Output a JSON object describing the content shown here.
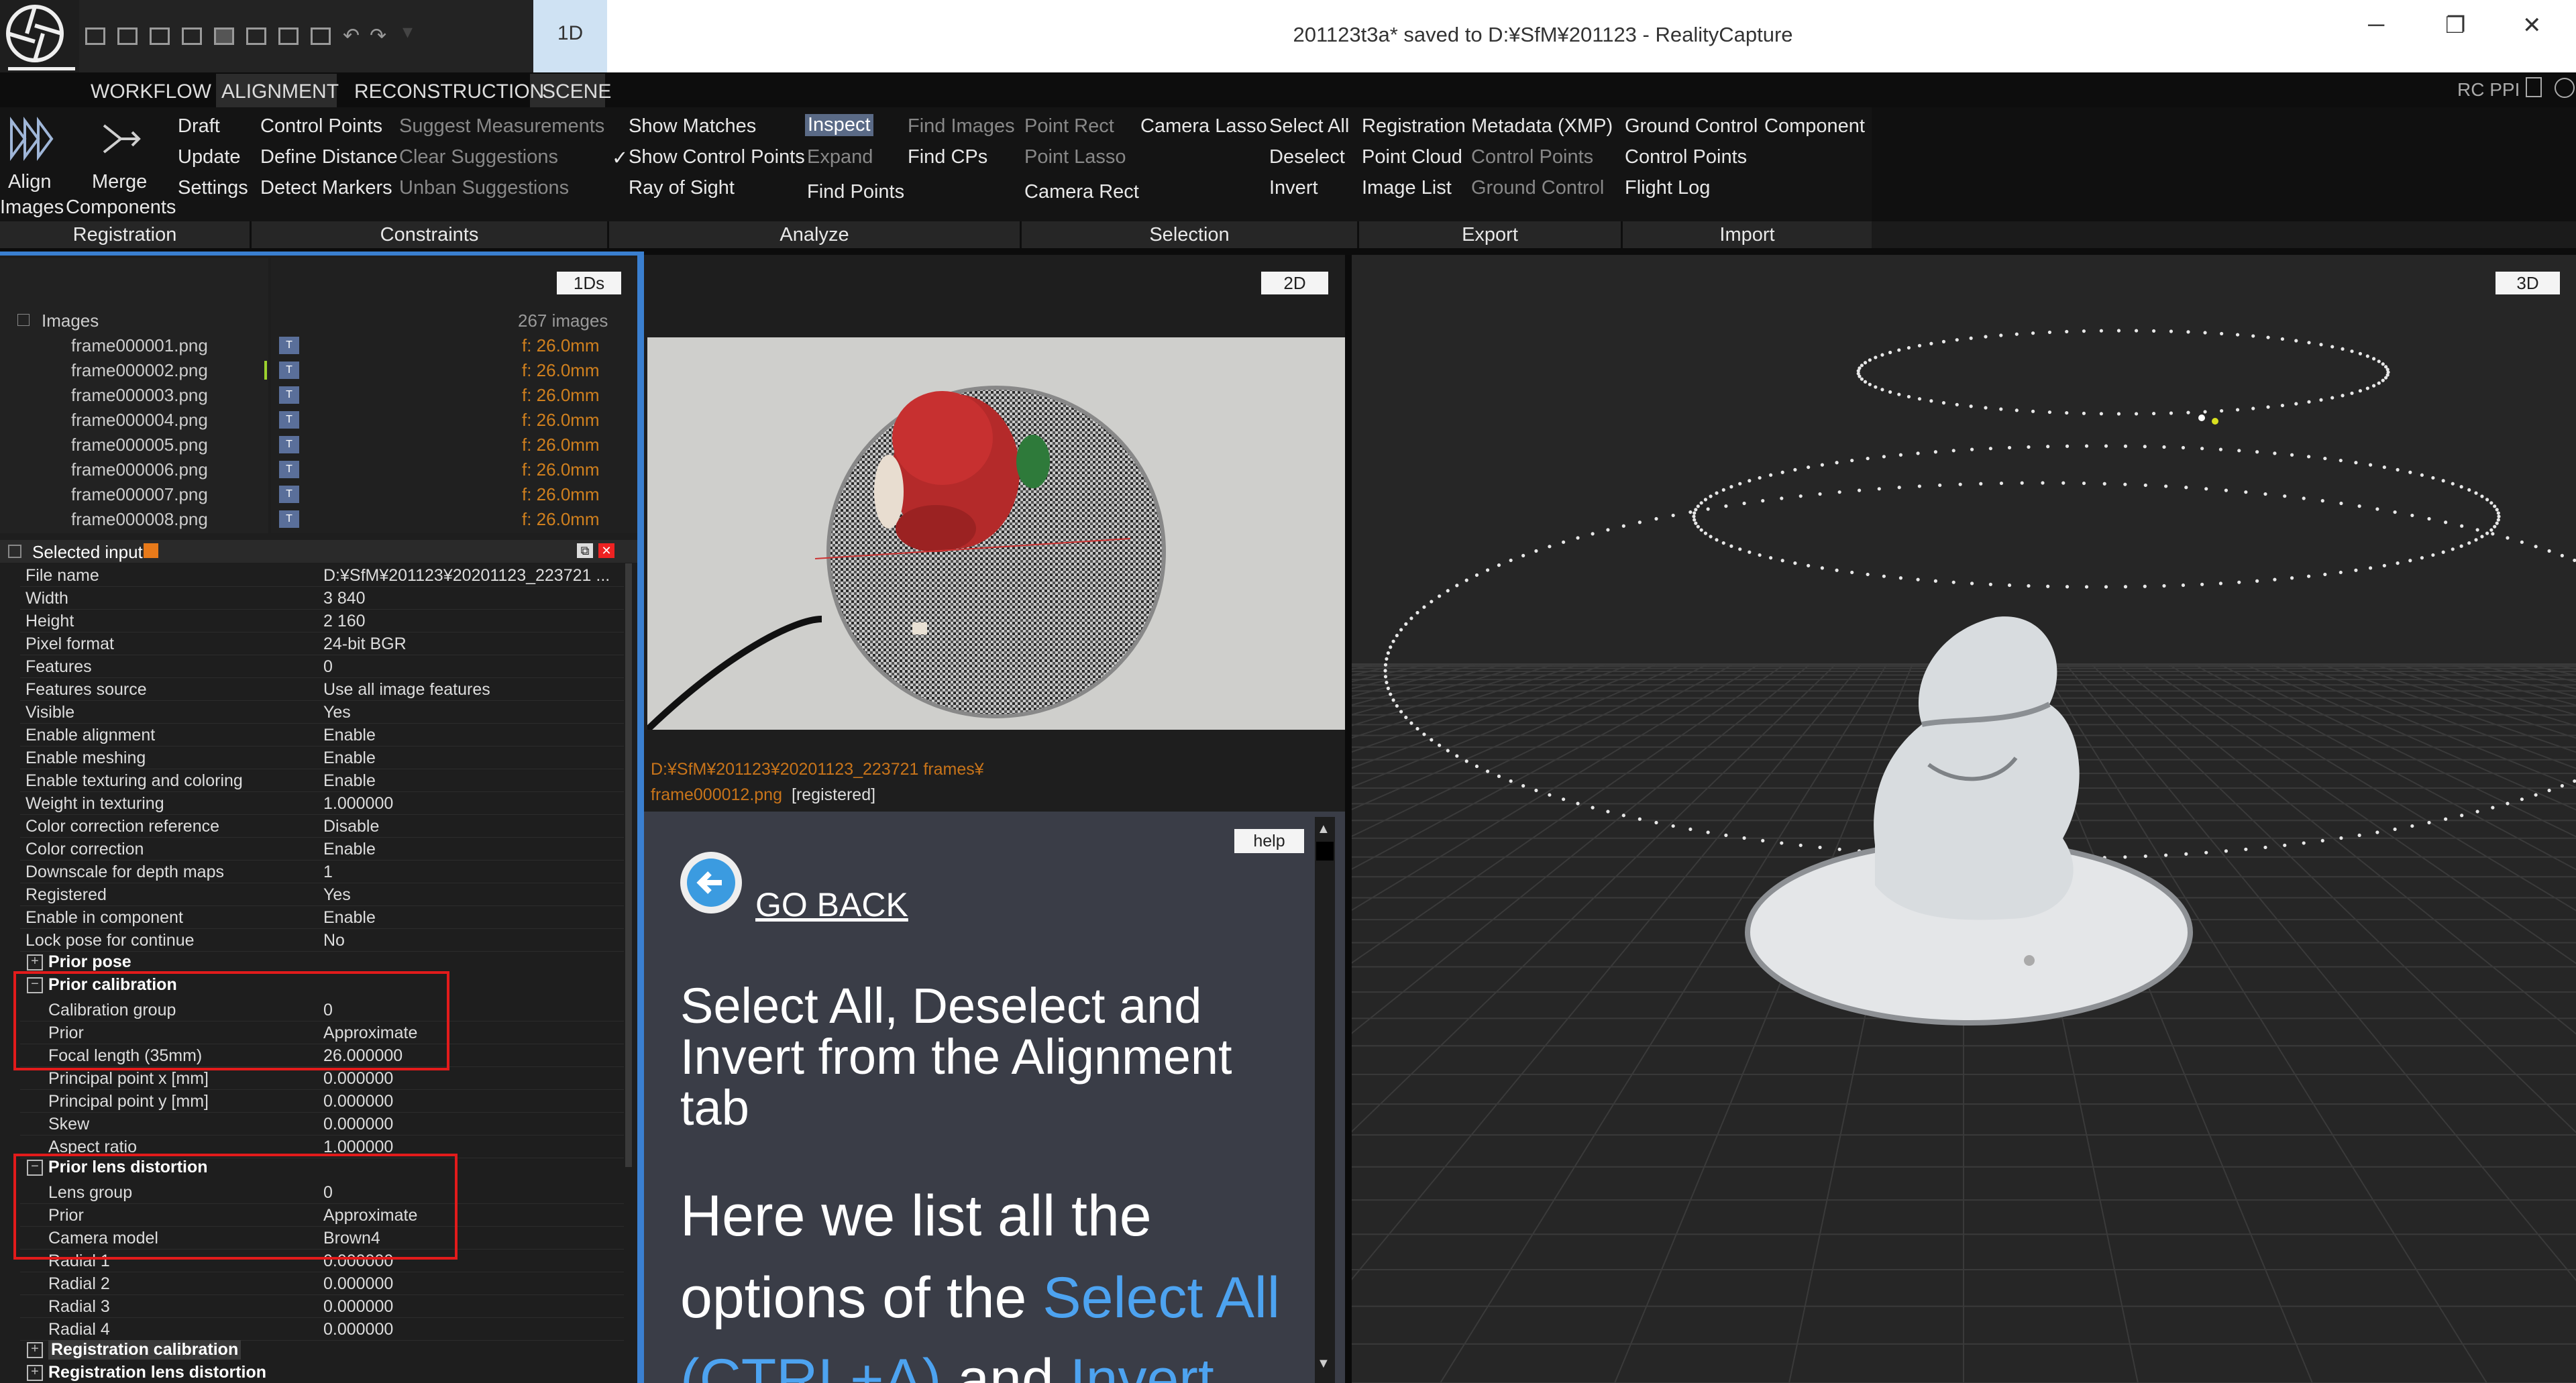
{
  "window": {
    "title": "201123t3a* saved to D:¥SfM¥201123 - RealityCapture",
    "layout_label": "1D",
    "minimize": "─",
    "restore": "❐",
    "close": "✕"
  },
  "menu": {
    "items": [
      "WORKFLOW",
      "ALIGNMENT",
      "RECONSTRUCTION",
      "SCENE"
    ],
    "active": "ALIGNMENT"
  },
  "header_right": {
    "label": "RC PPI"
  },
  "ribbon": {
    "align_images": [
      "Align",
      "Images"
    ],
    "merge_components": [
      "Merge",
      "Components"
    ],
    "draft": "Draft",
    "update": "Update",
    "settings": "Settings",
    "control_points": "Control Points",
    "define_distance": "Define Distance",
    "detect_markers": "Detect Markers",
    "suggest_measurements": "Suggest Measurements",
    "clear_suggestions": "Clear Suggestions",
    "unban_suggestions": "Unban Suggestions",
    "show_matches": "Show Matches",
    "show_control_points": "Show Control Points",
    "show_control_points_check": "✓",
    "ray_of_sight": "Ray of Sight",
    "inspect": "Inspect",
    "expand": "Expand",
    "find_points": "Find Points",
    "find_images": "Find Images",
    "find_cps": "Find CPs",
    "point_rect": "Point Rect",
    "point_lasso": "Point Lasso",
    "camera_rect": "Camera Rect",
    "camera_lasso": "Camera Lasso",
    "select_all": "Select All",
    "deselect": "Deselect",
    "invert": "Invert",
    "registration": "Registration",
    "point_cloud": "Point Cloud",
    "image_list": "Image List",
    "metadata_xmp": "Metadata (XMP)",
    "export_control_points": "Control Points",
    "export_ground_control": "Ground Control",
    "import_ground_control": "Ground Control",
    "import_component": "Component",
    "import_control_points": "Control Points",
    "flight_log": "Flight Log",
    "groups": [
      "Registration",
      "Constraints",
      "Analyze",
      "Selection",
      "Export",
      "Import"
    ]
  },
  "images_panel": {
    "view_button": "1Ds",
    "root_label": "Images",
    "count": "267 images",
    "badge": "T",
    "files": [
      {
        "name": "frame000001.png",
        "focal": "f: 26.0mm"
      },
      {
        "name": "frame000002.png",
        "focal": "f: 26.0mm"
      },
      {
        "name": "frame000003.png",
        "focal": "f: 26.0mm"
      },
      {
        "name": "frame000004.png",
        "focal": "f: 26.0mm"
      },
      {
        "name": "frame000005.png",
        "focal": "f: 26.0mm"
      },
      {
        "name": "frame000006.png",
        "focal": "f: 26.0mm"
      },
      {
        "name": "frame000007.png",
        "focal": "f: 26.0mm"
      },
      {
        "name": "frame000008.png",
        "focal": "f: 26.0mm"
      }
    ]
  },
  "inspector": {
    "title": "Selected input",
    "rows": [
      {
        "k": "File name",
        "v": "D:¥SfM¥201123¥20201123_223721 ..."
      },
      {
        "k": "Width",
        "v": "3 840"
      },
      {
        "k": "Height",
        "v": "2 160"
      },
      {
        "k": "Pixel format",
        "v": "24-bit BGR"
      },
      {
        "k": "Features",
        "v": "0"
      },
      {
        "k": "Features source",
        "v": "Use all image features"
      },
      {
        "k": "Visible",
        "v": "Yes"
      },
      {
        "k": "Enable alignment",
        "v": "Enable"
      },
      {
        "k": "Enable meshing",
        "v": "Enable"
      },
      {
        "k": "Enable texturing and coloring",
        "v": "Enable"
      },
      {
        "k": "Weight in texturing",
        "v": "1.000000"
      },
      {
        "k": "Color correction reference",
        "v": "Disable"
      },
      {
        "k": "Color correction",
        "v": "Enable"
      },
      {
        "k": "Downscale for depth maps",
        "v": "1"
      },
      {
        "k": "Registered",
        "v": "Yes"
      },
      {
        "k": "Enable in component",
        "v": "Enable"
      },
      {
        "k": "Lock pose for continue",
        "v": "No"
      }
    ],
    "prior_pose": "Prior pose",
    "prior_calibration": "Prior calibration",
    "calib_rows": [
      {
        "k": "Calibration group",
        "v": "0"
      },
      {
        "k": "Prior",
        "v": "Approximate"
      },
      {
        "k": "Focal length (35mm)",
        "v": "26.000000"
      },
      {
        "k": "Principal point x [mm]",
        "v": "0.000000"
      },
      {
        "k": "Principal point y [mm]",
        "v": "0.000000"
      },
      {
        "k": "Skew",
        "v": "0.000000"
      },
      {
        "k": "Aspect ratio",
        "v": "1.000000"
      }
    ],
    "prior_lens": "Prior lens distortion",
    "lens_rows": [
      {
        "k": "Lens group",
        "v": "0"
      },
      {
        "k": "Prior",
        "v": "Approximate"
      },
      {
        "k": "Camera model",
        "v": "Brown4"
      },
      {
        "k": "Radial 1",
        "v": "0.000000"
      },
      {
        "k": "Radial 2",
        "v": "0.000000"
      },
      {
        "k": "Radial 3",
        "v": "0.000000"
      },
      {
        "k": "Radial 4",
        "v": "0.000000"
      }
    ],
    "reg_calibration": "Registration calibration",
    "reg_lens": "Registration lens distortion"
  },
  "view2d": {
    "button": "2D",
    "path_line1": "D:¥SfM¥201123¥20201123_223721 frames¥",
    "path_file": "frame000012.png",
    "path_status": "[registered]"
  },
  "help": {
    "button": "help",
    "go_back": "GO BACK",
    "heading": "Select All, Deselect and Invert from the Alignment tab",
    "body_1": "Here we list all the options of the ",
    "body_link1": "Select All (CTRL+A)",
    "body_2": " and ",
    "body_link2": "Invert"
  },
  "view3d": {
    "button": "3D"
  },
  "colors": {
    "accent_blue": "#3a7fd0",
    "focal_orange": "#d0801e",
    "highlight_red": "#e21b1b",
    "help_link": "#4da3f0"
  }
}
